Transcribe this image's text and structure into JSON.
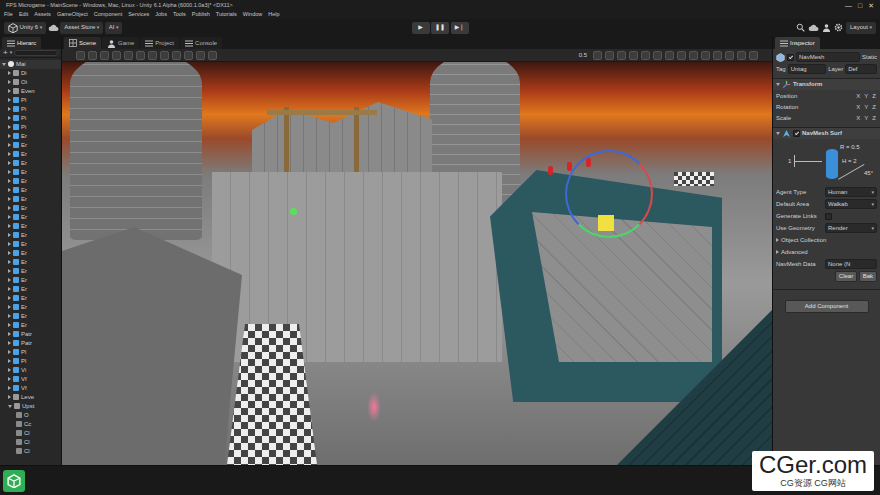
{
  "window": {
    "title": "FPS Microgame - MainScene - Windows, Mac, Linux - Unity 6.1 Alpha (6000.1.0a3)* <DX11>",
    "controls": [
      "—",
      "□",
      "✕"
    ]
  },
  "menu": [
    "File",
    "Edit",
    "Assets",
    "GameObject",
    "Component",
    "Services",
    "Jobs",
    "Tools",
    "Publish",
    "Tutorials",
    "Window",
    "Help"
  ],
  "toolbar": {
    "account": "Unity 6",
    "asset_store": "Asset Store",
    "ai": "AI",
    "dropdown_glyph": "▾",
    "play_controls": [
      {
        "glyph": "▶",
        "selected": false
      },
      {
        "glyph": "❚❚",
        "selected": false
      },
      {
        "glyph": "▶❘",
        "selected": false
      }
    ],
    "layout": "Layout"
  },
  "hierarchy": {
    "tab": "Hierarc",
    "add": "+",
    "items": [
      {
        "label": "Mai",
        "kind": "scene",
        "expanded": true
      },
      {
        "label": "Di",
        "kind": "object",
        "expanded": false
      },
      {
        "label": "Oi",
        "kind": "object",
        "expanded": false
      },
      {
        "label": "Even",
        "kind": "object",
        "expanded": false
      },
      {
        "label": "Pl",
        "kind": "prefab",
        "expanded": false
      },
      {
        "label": "Pi",
        "kind": "prefab",
        "expanded": false
      },
      {
        "label": "Pi",
        "kind": "prefab",
        "expanded": false
      },
      {
        "label": "Pi",
        "kind": "prefab",
        "expanded": false
      },
      {
        "label": "Er",
        "kind": "prefab",
        "expanded": false
      },
      {
        "label": "Er",
        "kind": "prefab",
        "expanded": false
      },
      {
        "label": "Er",
        "kind": "prefab",
        "expanded": false
      },
      {
        "label": "Er",
        "kind": "prefab",
        "expanded": false
      },
      {
        "label": "Er",
        "kind": "prefab",
        "expanded": false
      },
      {
        "label": "Er",
        "kind": "prefab",
        "expanded": false
      },
      {
        "label": "Er",
        "kind": "prefab",
        "expanded": false
      },
      {
        "label": "Er",
        "kind": "prefab",
        "expanded": false
      },
      {
        "label": "Er",
        "kind": "prefab",
        "expanded": false
      },
      {
        "label": "Er",
        "kind": "prefab",
        "expanded": false
      },
      {
        "label": "Er",
        "kind": "prefab",
        "expanded": false
      },
      {
        "label": "Er",
        "kind": "prefab",
        "expanded": false
      },
      {
        "label": "Er",
        "kind": "prefab",
        "expanded": false
      },
      {
        "label": "Er",
        "kind": "prefab",
        "expanded": false
      },
      {
        "label": "Er",
        "kind": "prefab",
        "expanded": false
      },
      {
        "label": "Er",
        "kind": "prefab",
        "expanded": false
      },
      {
        "label": "Er",
        "kind": "prefab",
        "expanded": false
      },
      {
        "label": "Er",
        "kind": "prefab",
        "expanded": false
      },
      {
        "label": "Er",
        "kind": "prefab",
        "expanded": false
      },
      {
        "label": "Er",
        "kind": "prefab",
        "expanded": false
      },
      {
        "label": "Er",
        "kind": "prefab",
        "expanded": false
      },
      {
        "label": "Er",
        "kind": "prefab",
        "expanded": false
      },
      {
        "label": "Patr",
        "kind": "prefab",
        "expanded": false
      },
      {
        "label": "Patr",
        "kind": "prefab",
        "expanded": false
      },
      {
        "label": "Pl",
        "kind": "prefab",
        "expanded": false
      },
      {
        "label": "Pl",
        "kind": "prefab",
        "expanded": false
      },
      {
        "label": "Vi",
        "kind": "prefab",
        "expanded": false
      },
      {
        "label": "Vf",
        "kind": "prefab",
        "expanded": false
      },
      {
        "label": "Vf",
        "kind": "prefab",
        "expanded": false
      },
      {
        "label": "Leve",
        "kind": "object",
        "expanded": false
      },
      {
        "label": "Upst",
        "kind": "object",
        "expanded": true
      },
      {
        "label": "O",
        "kind": "child"
      },
      {
        "label": "Cc",
        "kind": "child"
      },
      {
        "label": "Cl",
        "kind": "child"
      },
      {
        "label": "Cl",
        "kind": "child"
      },
      {
        "label": "Cl",
        "kind": "child"
      }
    ]
  },
  "scene_tabs": [
    {
      "label": "Scene",
      "selected": true
    },
    {
      "label": "Game",
      "selected": false
    },
    {
      "label": "Project",
      "selected": false
    },
    {
      "label": "Console",
      "selected": false
    }
  ],
  "scene_view": {
    "zoom": "0.5"
  },
  "inspector": {
    "tab": "Inspector",
    "active": true,
    "object_name": "NavMesh",
    "static": "Static",
    "tag_label": "Tag",
    "tag": "Untag",
    "layer_label": "Layer",
    "layer": "Def",
    "transform": {
      "title": "Transform",
      "expanded": true,
      "rows": [
        {
          "label": "Position",
          "axes": [
            "X",
            "Y",
            "Z"
          ]
        },
        {
          "label": "Rotation",
          "axes": [
            "X",
            "Y",
            "Z"
          ]
        },
        {
          "label": "Scale",
          "axes": [
            "X",
            "Y",
            "Z"
          ]
        }
      ]
    },
    "surface": {
      "title": "NavMesh Surf",
      "expanded": true,
      "enabled": true,
      "diagram": {
        "step": "1",
        "radius": "R = 0.5",
        "height": "H = 2",
        "slope": "45°"
      },
      "fields": [
        {
          "label": "Agent Type",
          "kind": "dropdown",
          "value": "Human"
        },
        {
          "label": "Default Area",
          "kind": "dropdown",
          "value": "Walkab"
        },
        {
          "label": "Generate Links",
          "kind": "checkbox",
          "checked": false
        },
        {
          "label": "Use Geometry",
          "kind": "dropdown",
          "value": "Render"
        },
        {
          "label": "Object Collection",
          "kind": "foldout",
          "expanded": false
        },
        {
          "label": "Advanced",
          "kind": "foldout",
          "expanded": false
        },
        {
          "label": "NavMesh Data",
          "kind": "object",
          "value": "None (N"
        }
      ],
      "buttons": [
        "Clear",
        "Bak"
      ]
    },
    "add_component": "Add Component"
  },
  "watermark": {
    "text": "CGer.com",
    "subtext": "CG资源 CG网站"
  }
}
